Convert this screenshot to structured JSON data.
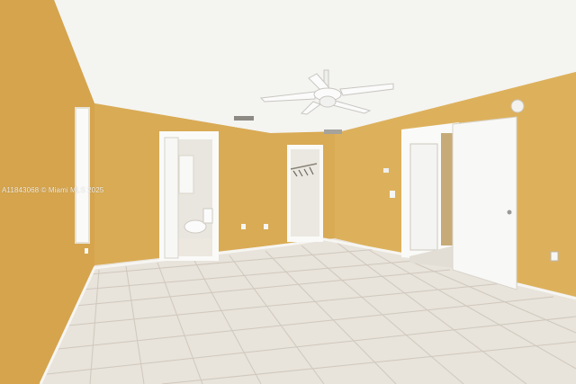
{
  "photo": {
    "watermark": "A11843068 © Miami MLS 2025",
    "colors": {
      "wall": "#dcae58",
      "wall_left": "#d4a24a",
      "ceiling": "#f6f6f4",
      "floor": "#e9e4dc",
      "door": "#f7f7f5",
      "trim": "#fbfbf9"
    }
  }
}
